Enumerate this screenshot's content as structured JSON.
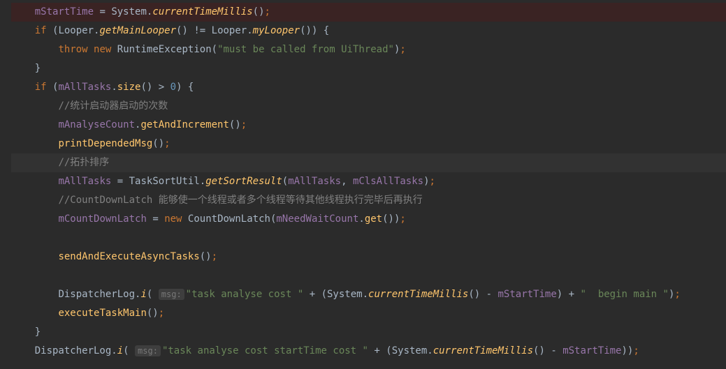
{
  "code": {
    "l1_field": "mStartTime",
    "l1_class": "System",
    "l1_method": "currentTimeMillis",
    "l2_class1": "Looper",
    "l2_method1": "getMainLooper",
    "l2_class2": "Looper",
    "l2_method2": "myLooper",
    "l3_kw_throw": "throw",
    "l3_kw_new": "new",
    "l3_class": "RuntimeException",
    "l3_string": "\"must be called from UiThread\"",
    "l5_field": "mAllTasks",
    "l5_method": "size",
    "l5_num": "0",
    "l6_comment": "//统计启动器启动的次数",
    "l7_field": "mAnalyseCount",
    "l7_method": "getAndIncrement",
    "l8_method": "printDependedMsg",
    "l9_comment": "//拓扑排序",
    "l10_field1": "mAllTasks",
    "l10_class": "TaskSortUtil",
    "l10_method": "getSortResult",
    "l10_arg1": "mAllTasks",
    "l10_arg2": "mClsAllTasks",
    "l11_comment": "//CountDownLatch 能够使一个线程或者多个线程等待其他线程执行完毕后再执行",
    "l12_field1": "mCountDownLatch",
    "l12_kw_new": "new",
    "l12_class": "CountDownLatch",
    "l12_field2": "mNeedWaitCount",
    "l12_method": "get",
    "l14_method": "sendAndExecuteAsyncTasks",
    "l16_class": "DispatcherLog",
    "l16_method": "i",
    "l16_hint": "msg:",
    "l16_str1": "\"task analyse cost \"",
    "l16_sys": "System",
    "l16_ctm": "currentTimeMillis",
    "l16_field": "mStartTime",
    "l16_str2": "\"  begin main \"",
    "l17_method": "executeTaskMain",
    "l19_class": "DispatcherLog",
    "l19_method": "i",
    "l19_hint": "msg:",
    "l19_str": "\"task analyse cost startTime cost \"",
    "l19_sys": "System",
    "l19_ctm": "currentTimeMillis",
    "l19_field": "mStartTime",
    "kw_if": "if",
    "kw_new": "new",
    "kw_throw": "throw"
  }
}
